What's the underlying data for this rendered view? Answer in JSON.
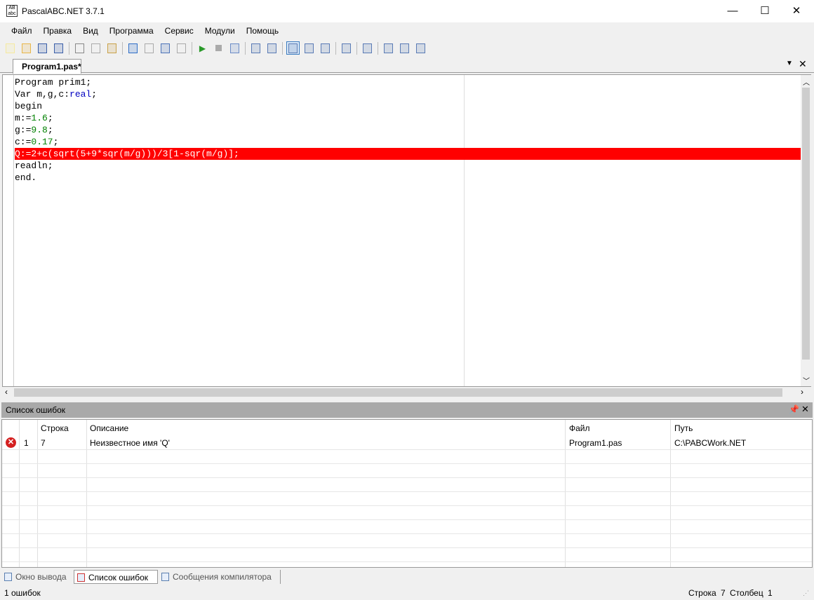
{
  "window": {
    "title": "PascalABC.NET 3.7.1",
    "icon_text": "AB\nabc",
    "minimize": "—",
    "maximize": "☐",
    "close": "✕"
  },
  "menu": [
    "Файл",
    "Правка",
    "Вид",
    "Программа",
    "Сервис",
    "Модули",
    "Помощь"
  ],
  "toolbar": [
    "new-file",
    "open",
    "save",
    "save-all",
    "cut",
    "copy",
    "paste",
    "undo",
    "redo",
    "back",
    "forward",
    "run",
    "stop",
    "debug",
    "step-over",
    "step-into",
    "output-window",
    "format",
    "abc-check",
    "compiler",
    "code",
    "module-d",
    "module-l",
    "module-r"
  ],
  "editor": {
    "tab_label": "Program1.pas*",
    "error_line": 7,
    "lines": [
      [
        {
          "t": "Program prim1;"
        }
      ],
      [
        {
          "t": "Var m,g,c:"
        },
        {
          "t": "real",
          "c": "kw"
        },
        {
          "t": ";"
        }
      ],
      [
        {
          "t": "begin"
        }
      ],
      [
        {
          "t": "m:="
        },
        {
          "t": "1.6",
          "c": "num"
        },
        {
          "t": ";"
        }
      ],
      [
        {
          "t": "g:="
        },
        {
          "t": "9.8",
          "c": "num"
        },
        {
          "t": ";"
        }
      ],
      [
        {
          "t": "c:="
        },
        {
          "t": "0.17",
          "c": "num"
        },
        {
          "t": ";"
        }
      ],
      [
        {
          "t": "Q:=2+c(sqrt(5+9*sqr(m/g)))/3[1-sqr(m/g)];"
        }
      ],
      [
        {
          "t": "readln;"
        }
      ],
      [
        {
          "t": "end."
        }
      ]
    ]
  },
  "error_panel": {
    "title": "Список ошибок",
    "columns": {
      "line": "Строка",
      "desc": "Описание",
      "file": "Файл",
      "path": "Путь"
    },
    "rows": [
      {
        "index": "1",
        "line": "7",
        "desc": "Неизвестное имя 'Q'",
        "file": "Program1.pas",
        "path": "C:\\PABCWork.NET"
      }
    ]
  },
  "bottom_tabs": [
    "Окно вывода",
    "Список ошибок",
    "Сообщения компилятора"
  ],
  "status": {
    "errors": "1 ошибок",
    "row_label": "Строка",
    "row": "7",
    "col_label": "Столбец",
    "col": "1"
  }
}
